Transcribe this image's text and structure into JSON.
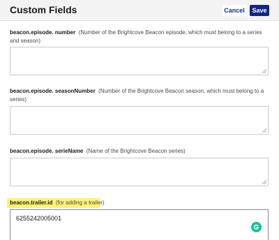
{
  "header": {
    "title": "Custom Fields",
    "cancel_label": "Cancel",
    "save_label": "Save"
  },
  "fields": [
    {
      "name": "beacon.episode. number",
      "description": "(Number of the Brightcove Beacon episode, which must belong to a series and season)",
      "value": ""
    },
    {
      "name": "beacon.episode. seasonNumber",
      "description": "(Number of the Brightcove Beacon season, which must belong to a series)",
      "value": ""
    },
    {
      "name": "beacon.episode. serieName",
      "description": "(Name of the Brightcove Beacon series)",
      "value": ""
    },
    {
      "name": "beacon.trailer.id",
      "description": "(for adding a trailer)",
      "value": "6255242005001"
    }
  ],
  "colors": {
    "save_button_bg": "#15277d",
    "highlight": "#fff27a",
    "grammarly": "#15c39a"
  },
  "icons": {
    "grammarly": "grammarly-icon",
    "resize": "resize-handle-icon"
  }
}
